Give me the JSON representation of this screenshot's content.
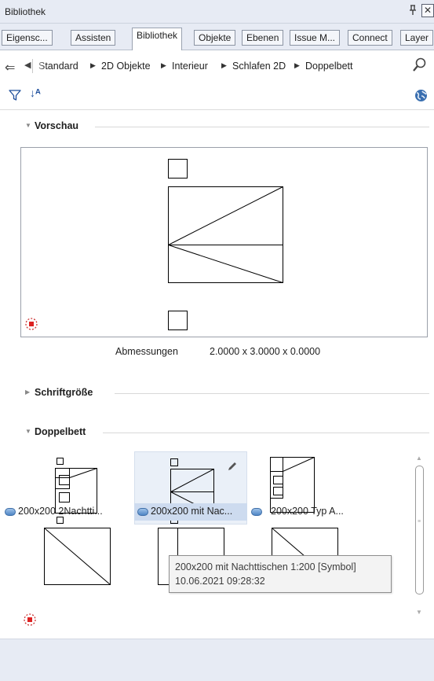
{
  "window": {
    "title": "Bibliothek",
    "pin_glyph": "⎐",
    "close_glyph": "✕"
  },
  "tabs": [
    {
      "label": "Eigensc...",
      "active": false
    },
    {
      "label": "Assisten",
      "active": false
    },
    {
      "label": "Bibliothek",
      "active": true
    },
    {
      "label": "Objekte",
      "active": false
    },
    {
      "label": "Ebenen",
      "active": false
    },
    {
      "label": "Issue M...",
      "active": false
    },
    {
      "label": "Connect",
      "active": false
    },
    {
      "label": "Layer",
      "active": false
    }
  ],
  "breadcrumb": {
    "back_glyph": "⇐",
    "left_glyph": "◀",
    "separator_glyph": "▶",
    "items": [
      "Standard",
      "2D Objekte",
      "Interieur",
      "Schlafen 2D",
      "Doppelbett"
    ]
  },
  "toolbar": {
    "sort_glyph": "↓ᴬ",
    "icons": [
      "filter-icon",
      "sort-az-icon",
      "globe-icon"
    ]
  },
  "sections": {
    "preview": {
      "label": "Vorschau",
      "expanded": true
    },
    "font_size": {
      "label": "Schriftgröße",
      "expanded": false
    },
    "double_bed": {
      "label": "Doppelbett",
      "expanded": true
    }
  },
  "preview": {
    "dimensions_label": "Abmessungen",
    "dimensions_value": "2.0000 x 3.0000 x 0.0000"
  },
  "items": [
    {
      "label": "200x200 2Nachtti...",
      "selected": false
    },
    {
      "label": "200x200 mit Nac...",
      "selected": true
    },
    {
      "label": "200x200 Typ A...",
      "selected": false
    }
  ],
  "tooltip": {
    "line1": "200x200 mit Nachttischen 1:200 [Symbol]",
    "line2": "10.06.2021 09:28:32"
  },
  "colors": {
    "accent": "#1e4f9c",
    "selection": "#cddbef",
    "chrome": "#e7ebf4"
  }
}
